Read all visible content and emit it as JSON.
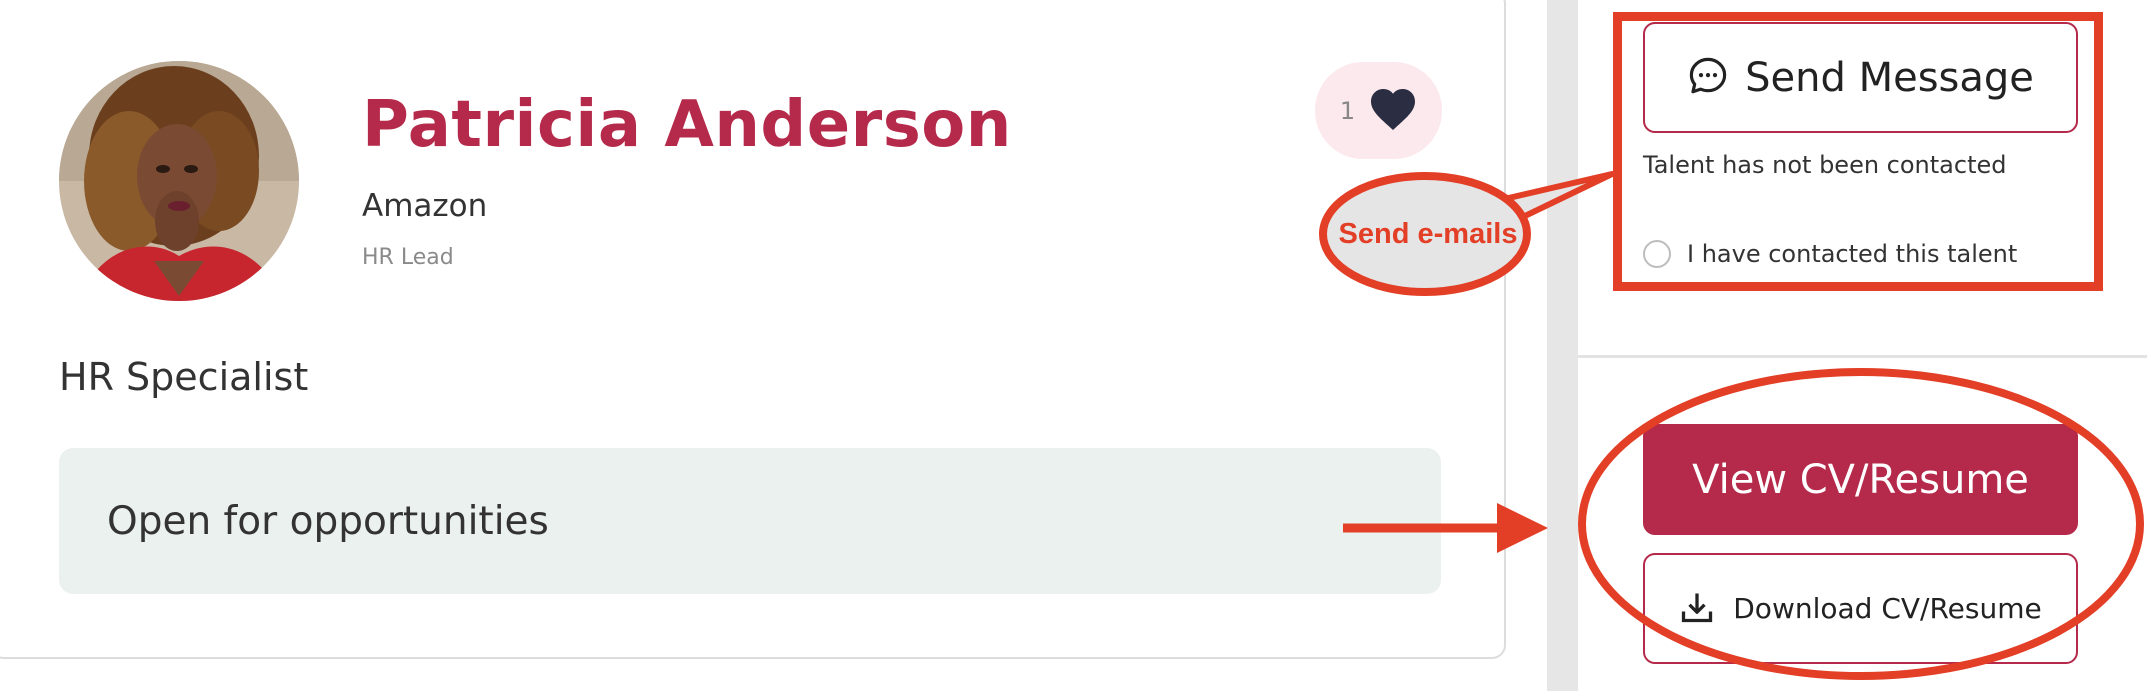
{
  "profile": {
    "name": "Patricia Anderson",
    "company": "Amazon",
    "role": "HR Lead",
    "headline": "HR Specialist",
    "status": "Open for opportunities",
    "likes": "1"
  },
  "contact": {
    "send_message_label": "Send Message",
    "status_text": "Talent has not been contacted",
    "checkbox_label": "I have contacted this talent"
  },
  "cv": {
    "view_label": "View CV/Resume",
    "download_label": "Download CV/Resume"
  },
  "annotations": {
    "callout_text": "Send e-mails"
  },
  "icons": {
    "like": "heart-icon",
    "message": "chat-bubble-icon",
    "download": "download-icon"
  },
  "colors": {
    "accent": "#b5294a",
    "annotation": "#e33e26",
    "status_bg": "#ebf1ef"
  }
}
